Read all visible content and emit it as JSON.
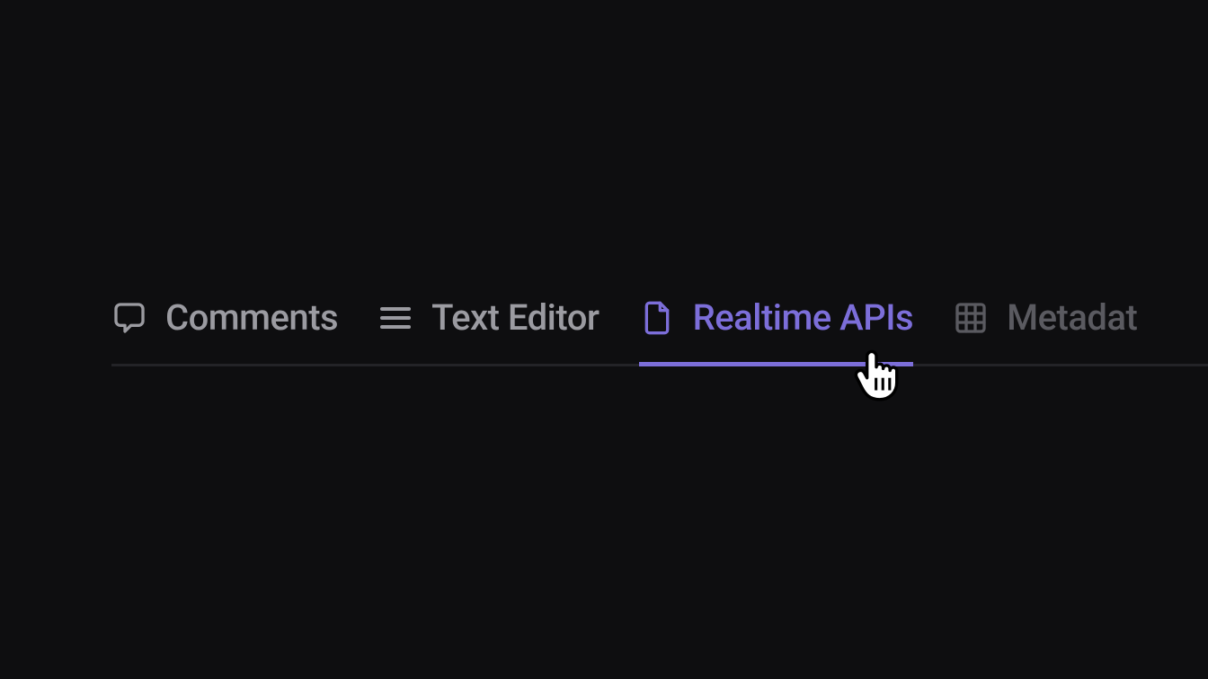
{
  "tabs": [
    {
      "label": "Comments",
      "active": false
    },
    {
      "label": "Text Editor",
      "active": false
    },
    {
      "label": "Realtime APIs",
      "active": true
    },
    {
      "label": "Metadat",
      "active": false
    }
  ],
  "colors": {
    "accent": "#7c6ed9",
    "text": "#9b9ba1",
    "text_dim": "#5a5a60",
    "background": "#0e0e10",
    "border": "#232327"
  }
}
